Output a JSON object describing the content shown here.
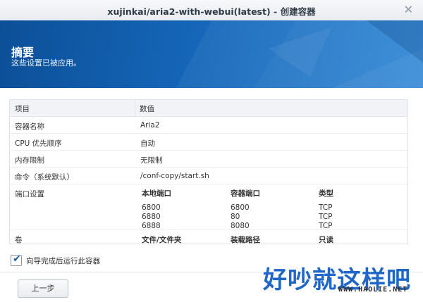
{
  "window": {
    "title": "xujinkai/aria2-with-webui(latest) - 创建容器",
    "close_glyph": "✕"
  },
  "banner": {
    "heading": "摘要",
    "subtitle": "这些设置已被应用。",
    "colors": {
      "dark": "#0c4f97",
      "light": "#2f86d6"
    }
  },
  "summary_table": {
    "headers": {
      "item": "项目",
      "value": "数值"
    },
    "rows": [
      {
        "key": "容器名称",
        "value": "Aria2"
      },
      {
        "key": "CPU 优先顺序",
        "value": "自动"
      },
      {
        "key": "内存限制",
        "value": "无限制"
      },
      {
        "key": "命令（系统默认）",
        "value": "/conf-copy/start.sh"
      }
    ],
    "ports": {
      "key": "端口设置",
      "headers": [
        "本地端口",
        "容器端口",
        "类型"
      ],
      "rows": [
        [
          "6800",
          "6800",
          "TCP"
        ],
        [
          "6880",
          "80",
          "TCP"
        ],
        [
          "6888",
          "8080",
          "TCP"
        ]
      ]
    },
    "volumes": {
      "key": "卷",
      "headers": [
        "文件/文件夹",
        "装载路径",
        "只读"
      ]
    }
  },
  "options": {
    "run_after_wizard": {
      "label": "向导完成后运行此容器",
      "checked": true
    }
  },
  "buttons": {
    "prev": "上一步"
  },
  "watermark": {
    "main": "好吵就这样吧",
    "sub": "WWW.HAOLIE.NET"
  }
}
